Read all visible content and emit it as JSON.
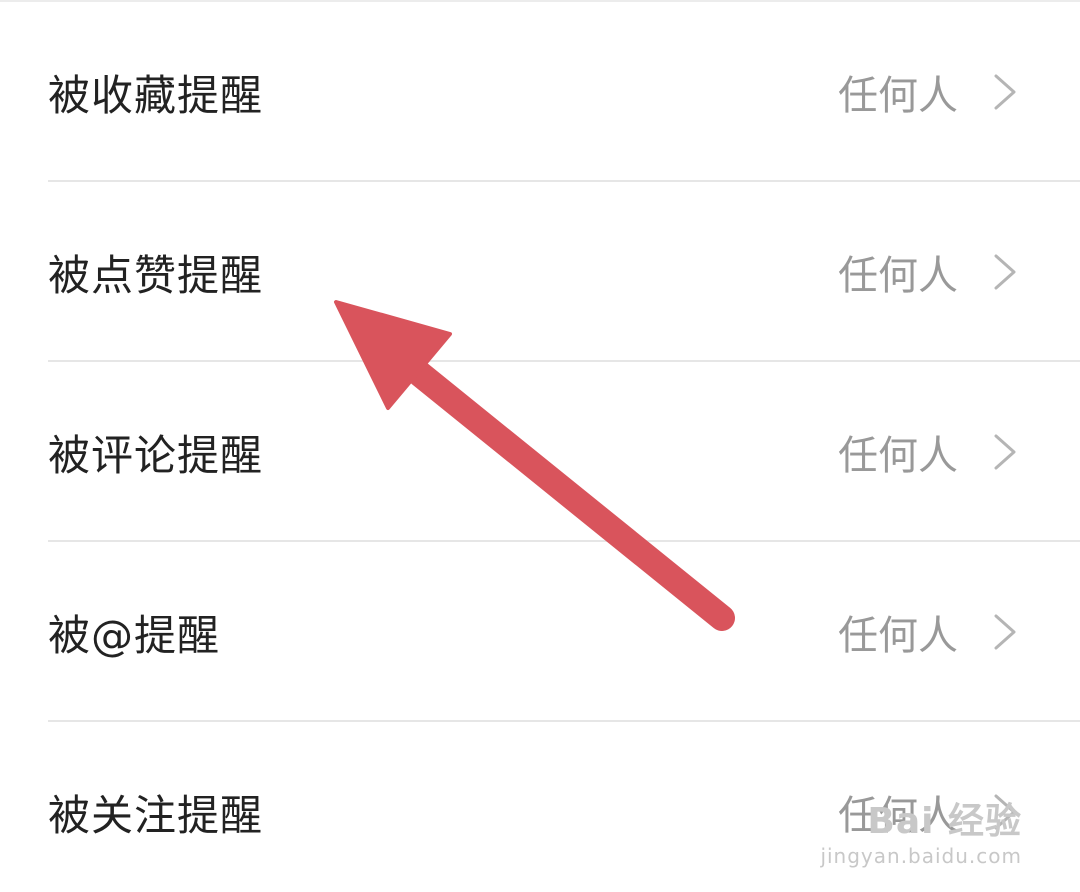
{
  "settings_list": [
    {
      "label": "被收藏提醒",
      "value": "任何人",
      "icon": "chevron-right-icon"
    },
    {
      "label": "被点赞提醒",
      "value": "任何人",
      "icon": "chevron-right-icon"
    },
    {
      "label": "被评论提醒",
      "value": "任何人",
      "icon": "chevron-right-icon"
    },
    {
      "label": "被@提醒",
      "value": "任何人",
      "icon": "chevron-right-icon"
    },
    {
      "label": "被关注提醒",
      "value": "任何人",
      "icon": "chevron-right-icon"
    }
  ],
  "colors": {
    "label_text": "#222222",
    "value_text": "#999999",
    "divider": "#e6e6e6",
    "annotation_arrow": "#d9545c"
  },
  "watermark": {
    "logo_text": "Bai 经验",
    "url": "jingyan.baidu.com"
  }
}
